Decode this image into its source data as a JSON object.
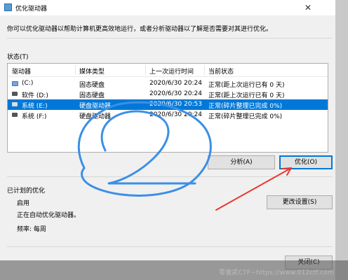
{
  "window": {
    "title": "优化驱动器",
    "close_glyph": "✕"
  },
  "description": "你可以优化驱动器以帮助计算机更高效地运行，或者分析驱动器以了解是否需要对其进行优化。",
  "status_label": "状态(T)",
  "table": {
    "headers": [
      "驱动器",
      "媒体类型",
      "上一次运行时间",
      "当前状态"
    ],
    "rows": [
      {
        "drive": "(C:)",
        "media": "固态硬盘",
        "last_run": "2020/6/30 20:24",
        "status": "正常(距上次运行已有 0 天)",
        "icon": "system-drive-icon"
      },
      {
        "drive": "软件 (D:)",
        "media": "固态硬盘",
        "last_run": "2020/6/30 20:24",
        "status": "正常(距上次运行已有 0 天)",
        "icon": "drive-icon"
      },
      {
        "drive": "系统 (E:)",
        "media": "硬盘驱动器",
        "last_run": "2020/6/30 20:53",
        "status": "正常(碎片整理已完成 0%)",
        "icon": "drive-icon"
      },
      {
        "drive": "系统 (F:)",
        "media": "硬盘驱动器",
        "last_run": "2020/6/30 20:24",
        "status": "正常(碎片整理已完成 0%)",
        "icon": "drive-icon"
      }
    ],
    "selected_index": 2
  },
  "buttons": {
    "analyze": "分析(A)",
    "optimize": "优化(O)",
    "change_settings": "更改设置(S)",
    "close": "关闭(C)"
  },
  "scheduled": {
    "heading": "已计划的优化",
    "state": "启用",
    "auto_text": "正在自动优化驱动器。",
    "frequency": "频率: 每周"
  },
  "watermark": "零壹贰CTF~https://www.012ctf.com",
  "annotation": {
    "number": "2",
    "scribble_color": "#3b8fe6",
    "arrow_color": "#e8382e"
  }
}
